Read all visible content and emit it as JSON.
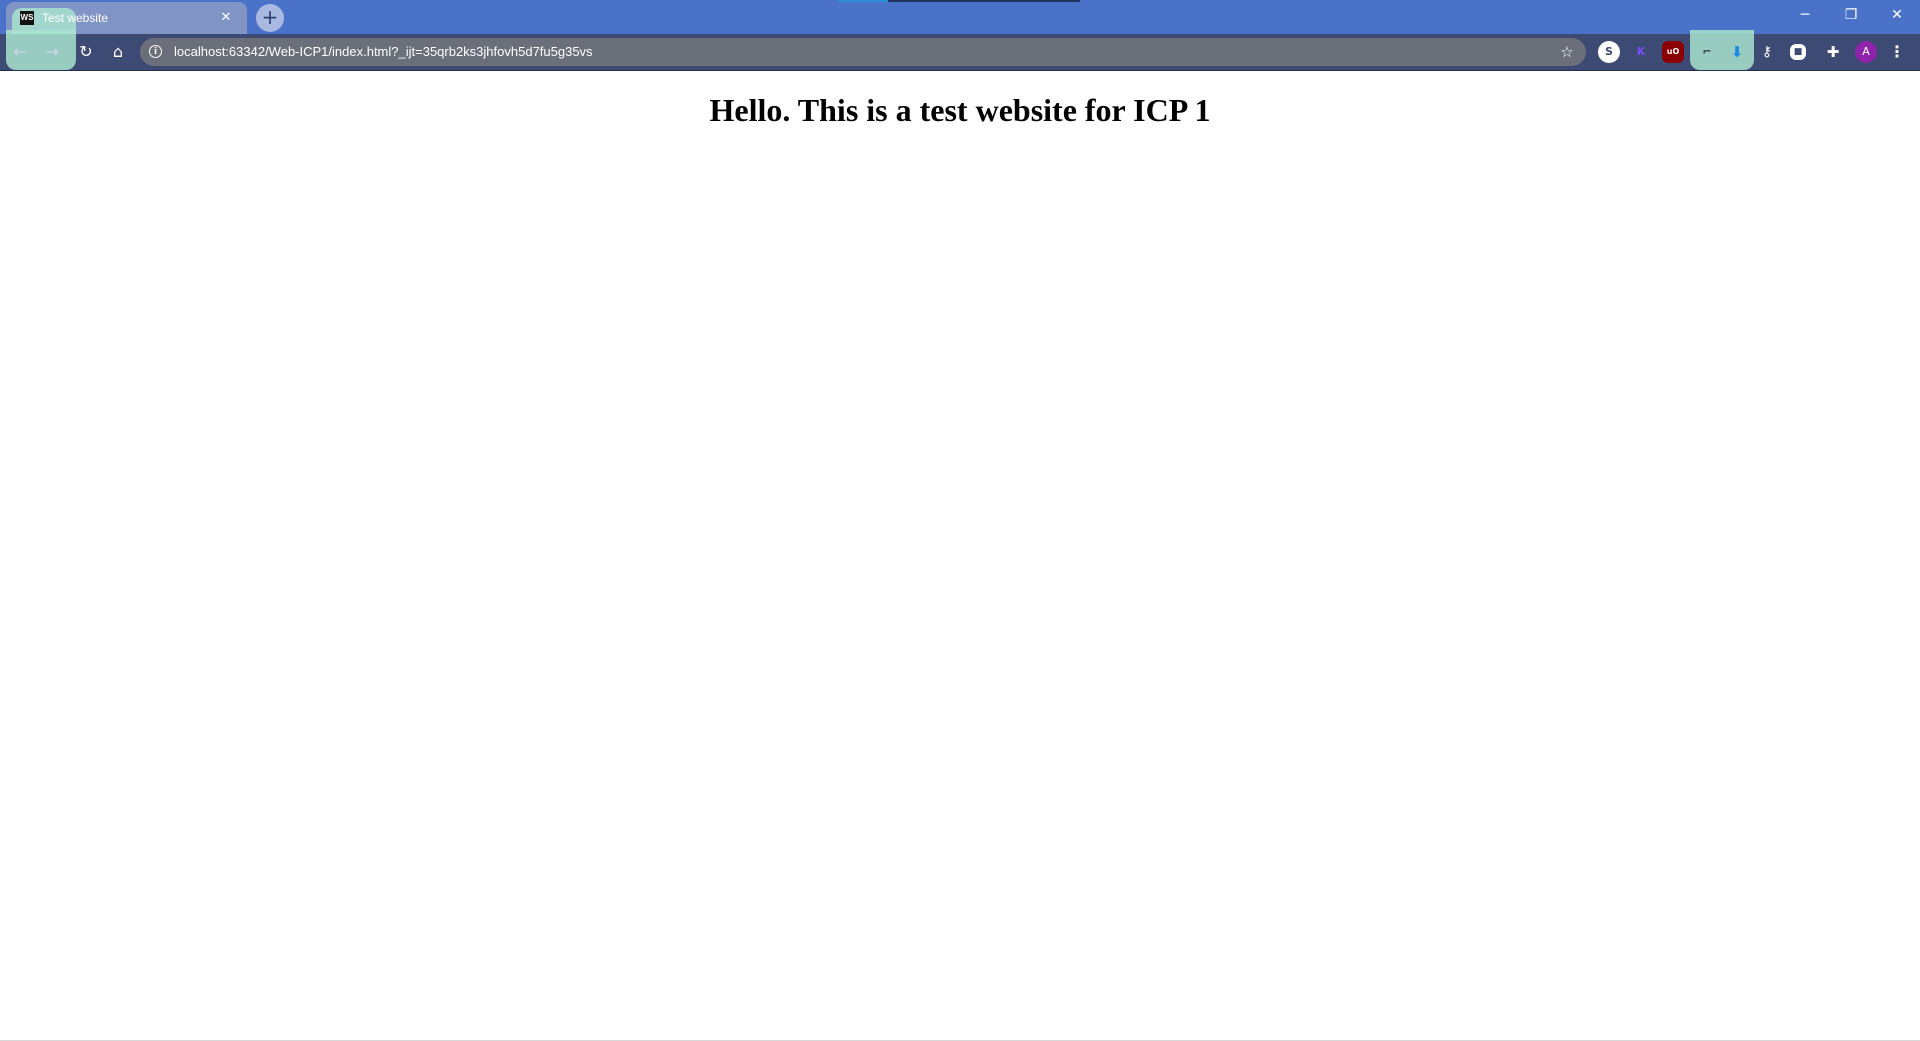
{
  "tab": {
    "title": "Test website",
    "favicon_text": "WS"
  },
  "window_controls": {
    "minimize": "─",
    "restore": "❐",
    "close": "✕"
  },
  "toolbar": {
    "url": "localhost:63342/Web-ICP1/index.html?_ijt=35qrb2ks3jhfovh5d7fu5g35vs",
    "profile_initial": "A"
  },
  "page": {
    "heading": "Hello. This is a test website for ICP 1"
  },
  "colors": {
    "tabstrip": "#4a72c8",
    "toolbar": "#3d4a73",
    "omnibox": "#6b6f7a",
    "profile": "#8e24aa"
  },
  "icons": {
    "back": "back-arrow-icon",
    "forward": "forward-arrow-icon",
    "reload": "reload-icon",
    "home": "home-icon",
    "info": "info-icon",
    "star": "star-icon",
    "extensions": "puzzle-icon",
    "menu": "kebab-menu-icon"
  }
}
